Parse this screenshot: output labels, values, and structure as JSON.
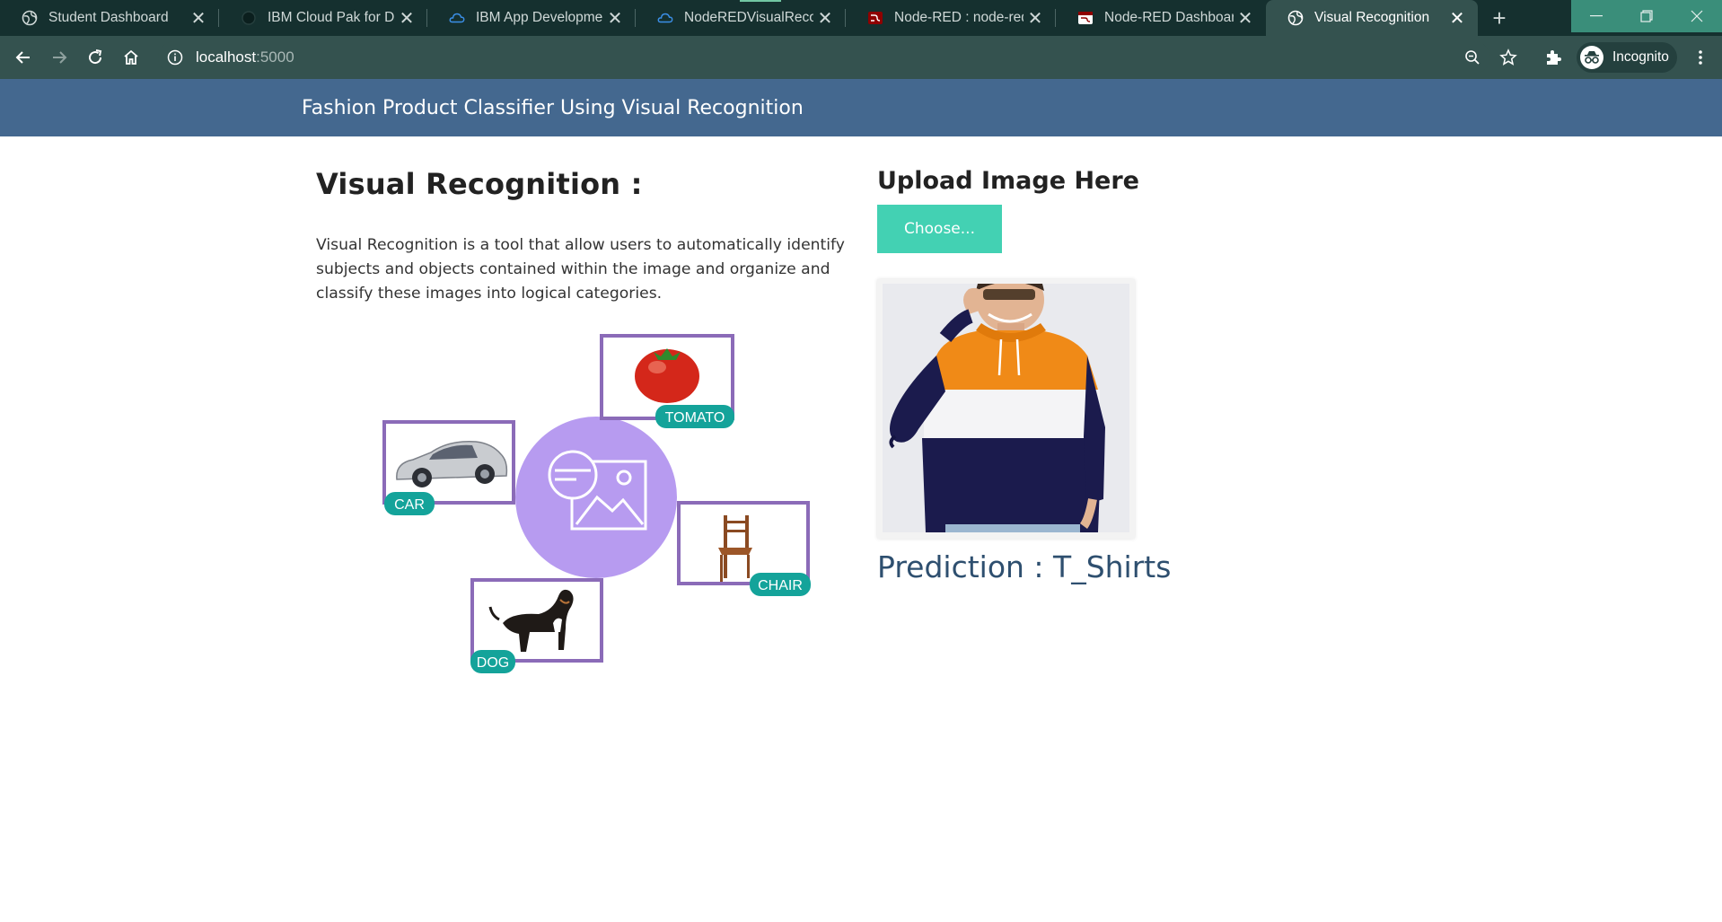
{
  "browser": {
    "tabs": [
      {
        "title": "Student Dashboard",
        "icon": "globe-icon"
      },
      {
        "title": "IBM Cloud Pak for Data",
        "icon": "ibm-cloud-pak-icon"
      },
      {
        "title": "IBM App Development",
        "icon": "ibm-cloud-icon"
      },
      {
        "title": "NodeREDVisualRecogn",
        "icon": "ibm-cloud-icon"
      },
      {
        "title": "Node-RED : node-red-",
        "icon": "node-red-icon"
      },
      {
        "title": "Node-RED Dashboard",
        "icon": "node-red-icon"
      },
      {
        "title": "Visual Recognition",
        "icon": "globe-icon",
        "active": true
      }
    ],
    "address": {
      "host": "localhost",
      "port": ":5000"
    },
    "profile_label": "Incognito"
  },
  "navbar": {
    "brand": "Fashion Product Classifier Using Visual Recognition"
  },
  "intro": {
    "heading": "Visual Recognition :",
    "description": "Visual Recognition is a tool that allow users to automatically identify subjects and objects contained within the image and organize and classify these images into logical categories."
  },
  "diagram": {
    "labels": {
      "tomato": "TOMATO",
      "car": "CAR",
      "chair": "CHAIR",
      "dog": "DOG"
    },
    "colors": {
      "frame": "#8b6bb8",
      "tag": "#14a39a",
      "circle": "#b79bf0"
    }
  },
  "upload": {
    "heading": "Upload Image Here",
    "choose_label": "Choose..."
  },
  "result": {
    "prediction": "Prediction : T_Shirts"
  },
  "colors": {
    "navbar": "#44688f",
    "button": "#43d1b3",
    "prediction_text": "#2e4f6f",
    "chrome_bg": "#15302f",
    "chrome_active": "#34524f"
  }
}
